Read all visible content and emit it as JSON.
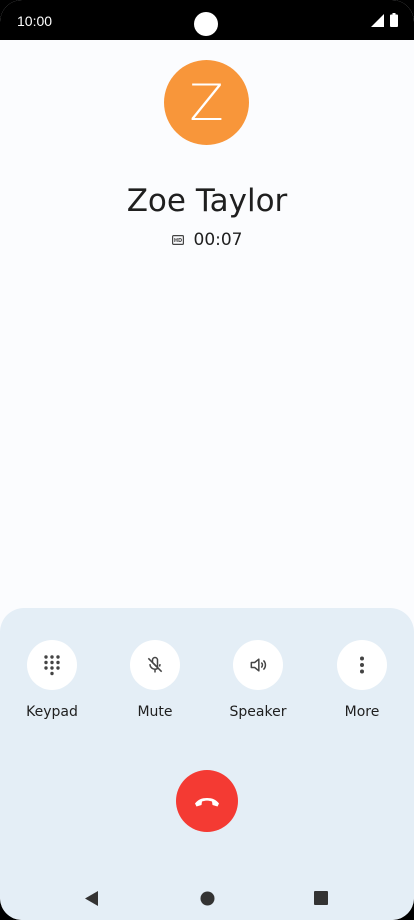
{
  "status_bar": {
    "time": "10:00"
  },
  "caller": {
    "initial": "Z",
    "avatar_color": "#f8963a",
    "name": "Zoe Taylor",
    "hd_icon": "hd-icon",
    "duration": "00:07"
  },
  "controls": [
    {
      "label": "Keypad",
      "icon": "dialpad-icon"
    },
    {
      "label": "Mute",
      "icon": "mic-off-icon"
    },
    {
      "label": "Speaker",
      "icon": "speaker-icon"
    },
    {
      "label": "More",
      "icon": "more-vert-icon"
    }
  ],
  "end_call": {
    "icon": "call-end-icon",
    "color": "#f43a33"
  },
  "nav_bar": {
    "back": "back-triangle-icon",
    "home": "home-circle-icon",
    "recents": "recents-square-icon"
  }
}
